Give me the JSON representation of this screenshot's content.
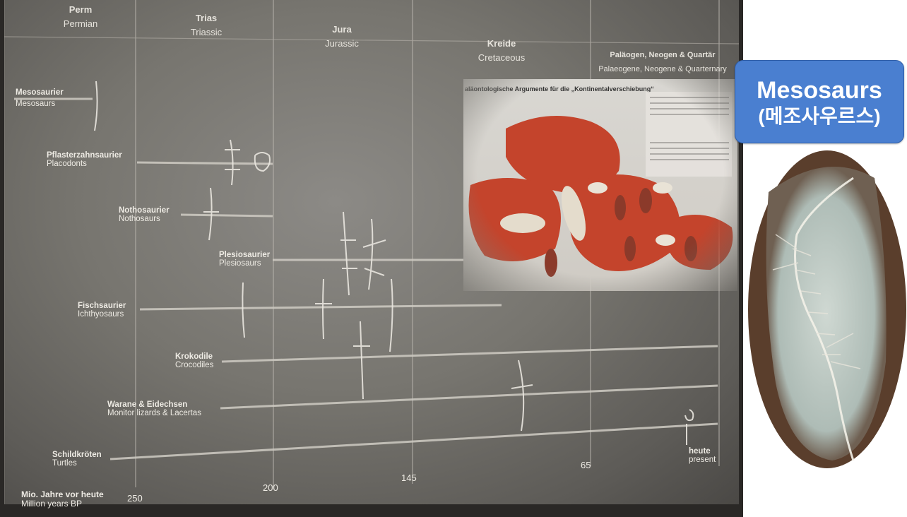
{
  "eras": [
    {
      "de": "Perm",
      "en": "Permian"
    },
    {
      "de": "Trias",
      "en": "Triassic"
    },
    {
      "de": "Jura",
      "en": "Jurassic"
    },
    {
      "de": "Kreide",
      "en": "Cretaceous"
    },
    {
      "de": "Paläogen, Neogen & Quartär",
      "en": "Palaeogene, Neogene & Quarternary"
    }
  ],
  "groups": [
    {
      "de": "Mesosaurier",
      "en": "Mesosaurs"
    },
    {
      "de": "Pflasterzahnsaurier",
      "en": "Placodonts"
    },
    {
      "de": "Nothosaurier",
      "en": "Nothosaurs"
    },
    {
      "de": "Plesiosaurier",
      "en": "Plesiosaurs"
    },
    {
      "de": "Fischsaurier",
      "en": "Ichthyosaurs"
    },
    {
      "de": "Krokodile",
      "en": "Crocodiles"
    },
    {
      "de": "Warane & Eidechsen",
      "en": "Monitor lizards & Lacertas"
    },
    {
      "de": "Schildkröten",
      "en": "Turtles"
    }
  ],
  "axis": {
    "label_de": "Mio. Jahre vor heute",
    "label_en": "Million years BP",
    "ticks": [
      "250",
      "200",
      "145",
      "65"
    ],
    "present_de": "heute",
    "present_en": "present"
  },
  "inset": {
    "title": "aläontologische Argumente für die „Kontinentalverschiebung“"
  },
  "badge": {
    "title": "Mesosaurs",
    "subtitle": "(메조사우르스)",
    "color": "#4a7fd0"
  }
}
